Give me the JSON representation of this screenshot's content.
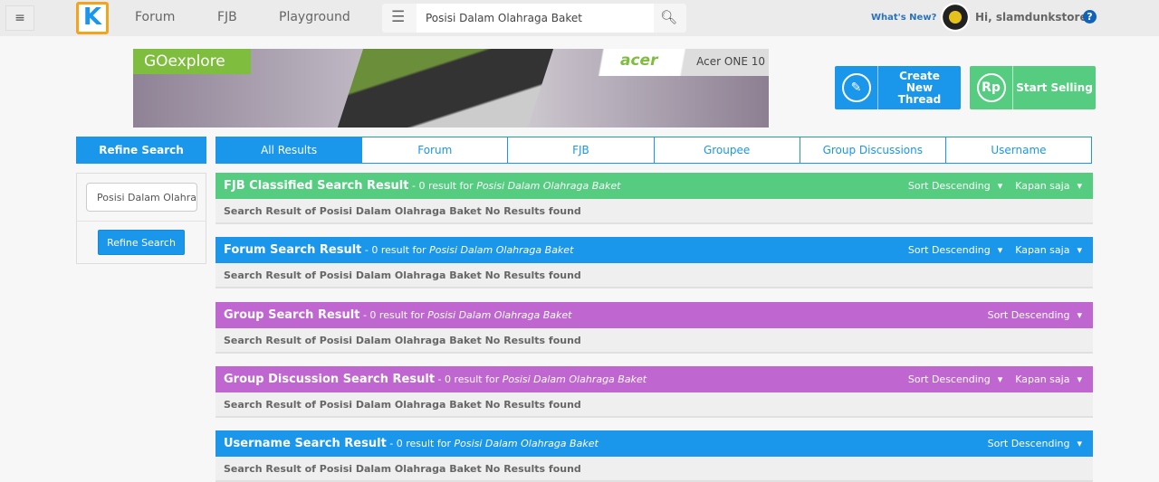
{
  "topbar": {
    "menu_icon": "hamburger-icon",
    "logo": "K",
    "nav": [
      "Forum",
      "FJB",
      "Playground"
    ],
    "search_value": "Posisi Dalam Olahraga Baket",
    "whats_new": "What's New?",
    "greeting": "Hi, slamdunkstore",
    "help": "?"
  },
  "banner": {
    "go": "GOexplore",
    "brand": "acer",
    "model": "Acer ONE 10"
  },
  "actions": {
    "create": "Create New Thread",
    "create_icon": "pencil-icon",
    "sell": "Start Selling",
    "sell_icon": "Rp"
  },
  "refine": {
    "title": "Refine Search",
    "input_value": "Posisi Dalam Olahraga Baket",
    "button": "Refine Search"
  },
  "tabs": [
    "All Results",
    "Forum",
    "FJB",
    "Groupee",
    "Group Discussions",
    "Username"
  ],
  "colors": {
    "green": "#55cc80",
    "blue": "#1a97ea",
    "purple": "#c066d0"
  },
  "sections": [
    {
      "title": "FJB Classified Search Result",
      "count": " - 0 result for ",
      "query": "Posisi Dalam Olahraga Baket",
      "sort": "Sort Descending",
      "time": "Kapan saja",
      "color": "#55cc80",
      "body": "Search Result of Posisi Dalam Olahraga Baket No Results found"
    },
    {
      "title": "Forum Search Result",
      "count": " - 0 result for ",
      "query": "Posisi Dalam Olahraga Baket",
      "sort": "Sort Descending",
      "time": "Kapan saja",
      "color": "#1a97ea",
      "body": "Search Result of Posisi Dalam Olahraga Baket No Results found"
    },
    {
      "title": "Group Search Result",
      "count": " - 0 result for ",
      "query": "Posisi Dalam Olahraga Baket",
      "sort": "Sort Descending",
      "color": "#c066d0",
      "body": "Search Result of Posisi Dalam Olahraga Baket No Results found"
    },
    {
      "title": "Group Discussion Search Result",
      "count": " - 0 result for ",
      "query": "Posisi Dalam Olahraga Baket",
      "sort": "Sort Descending",
      "time": "Kapan saja",
      "color": "#c066d0",
      "body": "Search Result of Posisi Dalam Olahraga Baket No Results found"
    },
    {
      "title": "Username Search Result",
      "count": " - 0 result for ",
      "query": "Posisi Dalam Olahraga Baket",
      "sort": "Sort Descending",
      "color": "#1a97ea",
      "body": "Search Result of Posisi Dalam Olahraga Baket No Results found"
    }
  ]
}
